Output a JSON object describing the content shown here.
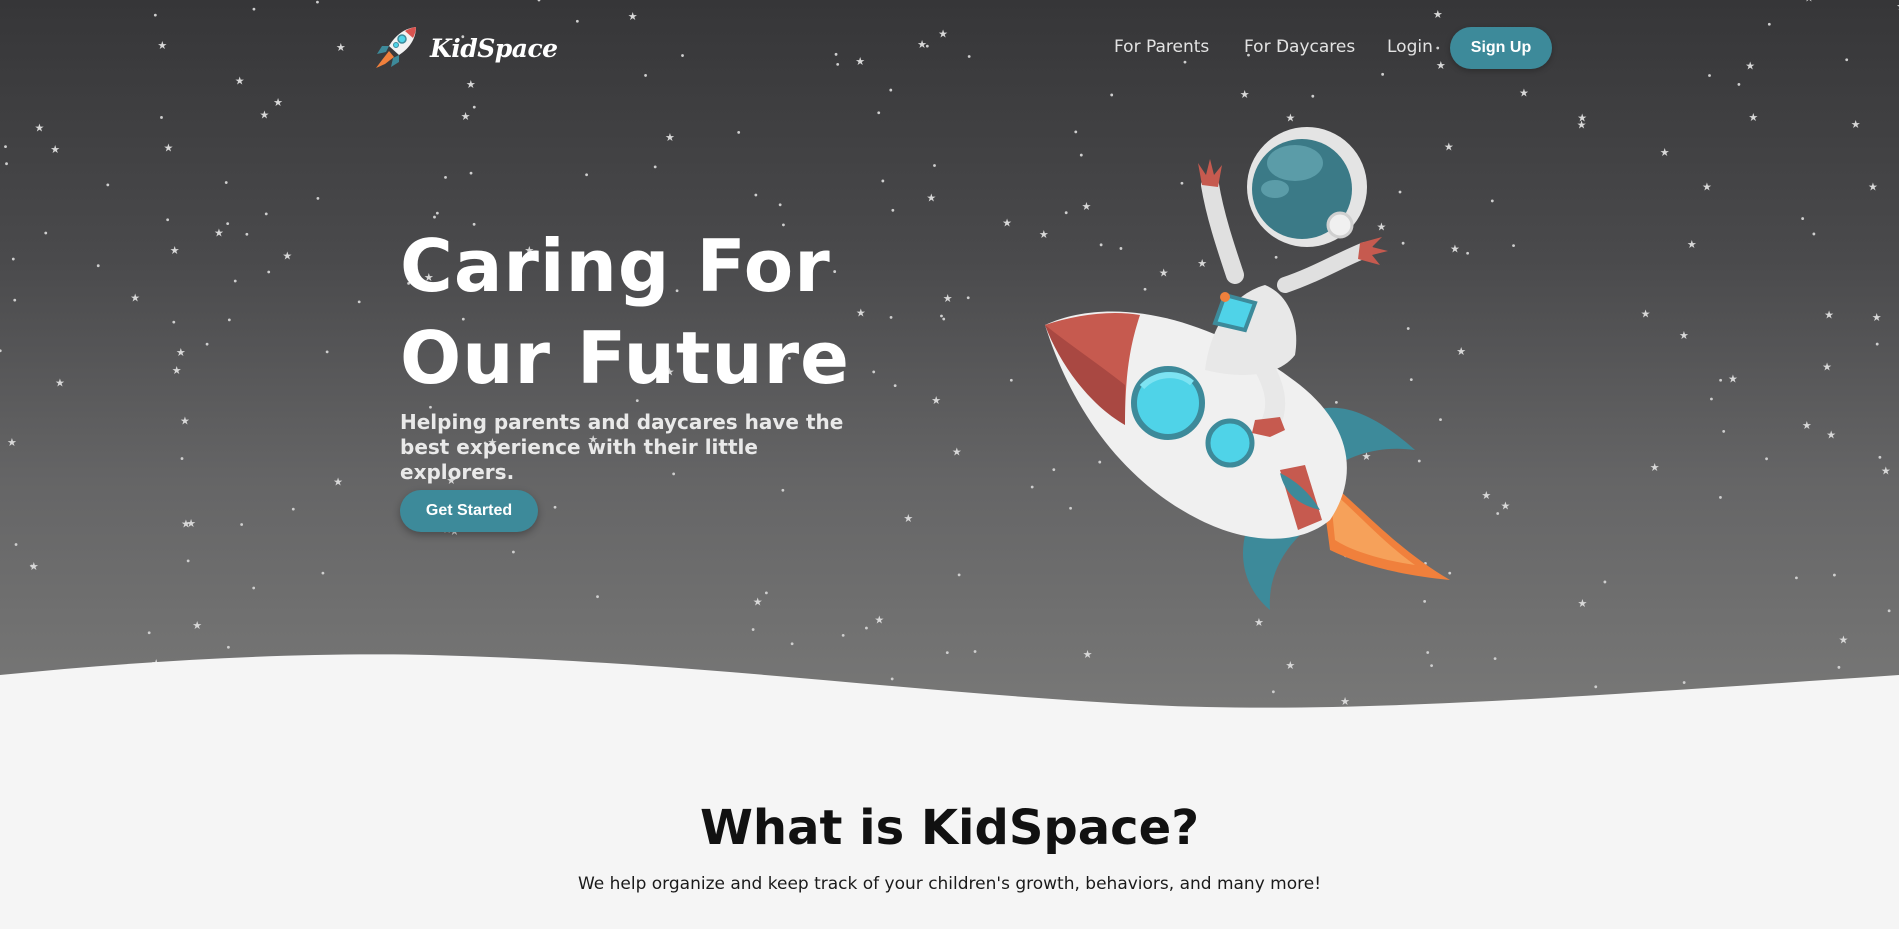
{
  "brand": {
    "name": "KidSpace",
    "logo_icon": "rocket-icon"
  },
  "nav": {
    "links": [
      "For Parents",
      "For Daycares",
      "Login"
    ],
    "signup_label": "Sign Up"
  },
  "hero": {
    "title_line1": "Caring For",
    "title_line2": "Our Future",
    "subtitle": "Helping parents and daycares have the best experience with their little explorers.",
    "cta_label": "Get Started",
    "illustration": "astronaut-riding-rocket"
  },
  "about": {
    "title": "What is KidSpace?",
    "text": "We help organize and keep track of your children's growth, behaviors, and many more!"
  },
  "colors": {
    "accent": "#3d8a9a",
    "hero_top": "#363638",
    "hero_bottom": "#7a7a79",
    "background": "#f5f5f5"
  }
}
